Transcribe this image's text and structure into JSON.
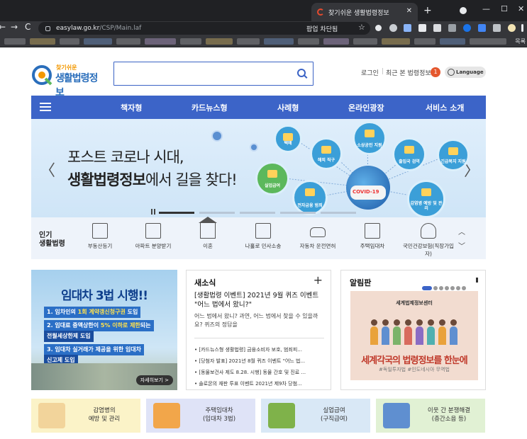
{
  "browser": {
    "tab_title": "찾기쉬운 생활법령정보",
    "tab_close": "✕",
    "new_tab": "+",
    "url_host": "easylaw.go.kr",
    "url_path": "/CSP/Main.laf",
    "popup_blocked": "팝업 차단됨",
    "bookmarks_more": "목록",
    "nav": {
      "back": "←",
      "forward": "→",
      "reload": "C"
    },
    "window": {
      "minimize": "—",
      "maximize": "☐",
      "close": "✕"
    }
  },
  "header": {
    "logo_sub": "찾기쉬운",
    "logo_main": "생활법령정보",
    "search_placeholder": "",
    "login": "로그인",
    "divider": "|",
    "recent": "최근 본 법령정보",
    "recent_count": "1",
    "language": "Language"
  },
  "gnb": {
    "items": [
      "책자형",
      "카드뉴스형",
      "사례형",
      "온라인광장",
      "서비스 소개"
    ]
  },
  "hero": {
    "line1": "포스트 코로나 시대,",
    "line2_bold": "생활법령정보",
    "line2_rest": "에서 길을 찾다!",
    "globe_label": "COVID-19",
    "bubbles": [
      "택배",
      "해외 직구",
      "소상공인 지원",
      "출입국 검역",
      "긴급복지 지원",
      "실업급여",
      "전자금융 범죄",
      "감염병 예방 및 관리"
    ],
    "prev": "〈",
    "next": "〉"
  },
  "popular": {
    "title_line1": "인기",
    "title_line2": "생활법령",
    "items": [
      "부동산등기",
      "아파트 분양받기",
      "이혼",
      "나홀로 민사소송",
      "자동차 운전면허",
      "주택임대차",
      "국민건강보험(직장가입자)"
    ],
    "up": "︿",
    "down": "﹀"
  },
  "ad": {
    "title": "임대차 3법 시행!!",
    "line1_pre": "1. 임차인의 ",
    "line1_em": "1회 계약갱신청구권",
    "line1_post": " 도입",
    "line2_pre": "2. 임대료 증액상한이 ",
    "line2_em": "5% 이하로 제한",
    "line2_post": "되는",
    "line2b": "전월세상한제 도입",
    "line3": "3. 임대차 실거래가 제공을 위한 임대차",
    "line3b": "신고제 도입",
    "more": "자세히보기 >"
  },
  "news": {
    "title": "새소식",
    "plus": "+",
    "headline": "[생활법령 이벤트] 2021년 9월 퀴즈 이벤트 \"어느 법에서 왔니?\"",
    "desc": "어느 법에서 왔니? 과연, 어느 법에서 찾을 수 있을까요? 퀴즈의 정답을",
    "list": [
      "[카드뉴스형 생활법령] 금융소비자 보호, 범죄피...",
      "[당첨자 발표] 2021년 8월 퀴즈 이벤트 \"어느 법...",
      "[동물보건사 제도 8.28. 시행] 동물 간호 및 진료 ...",
      "솔로몬의 재판 투표 이벤트 2021년 제9차 당첨..."
    ]
  },
  "notice": {
    "title": "알림판",
    "org": "세계법제정보센터",
    "big": "세계각국의 법령정보를 한눈에",
    "tags": "#독일투자법 #인도네시아 무역법"
  },
  "banners": [
    {
      "line1": "감염병의",
      "line2": "예방 및 관리",
      "bg": "#fbf3c8",
      "art": "#f2d49b"
    },
    {
      "line1": "주택임대차",
      "line2": "(임대차 3법)",
      "bg": "#dfe3f7",
      "art": "#f2a64a"
    },
    {
      "line1": "실업급여",
      "line2": "(구직급여)",
      "bg": "#d9e8f6",
      "art": "#7fb24a"
    },
    {
      "line1": "이웃 간 분쟁해결",
      "line2": "(층간소음 등)",
      "bg": "#e1f1d4",
      "art": "#5f8fd0"
    }
  ],
  "colors": {
    "primary": "#3c64c8",
    "accent": "#f39800"
  }
}
